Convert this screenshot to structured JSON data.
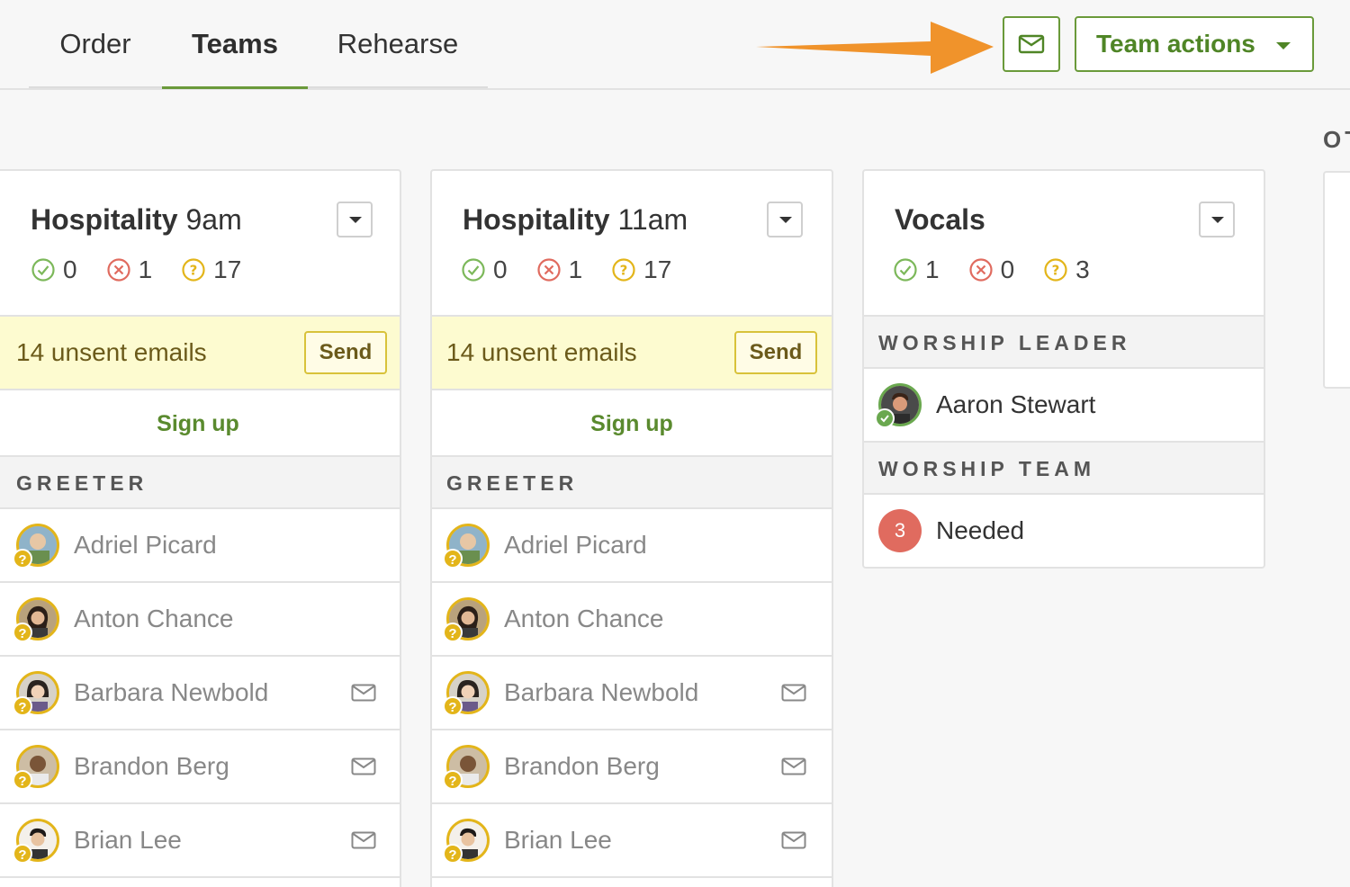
{
  "tabs": [
    {
      "label": "Order"
    },
    {
      "label": "Teams"
    },
    {
      "label": "Rehearse"
    }
  ],
  "toolbar": {
    "team_actions_label": "Team actions"
  },
  "offscreen_label": "OT",
  "cards": [
    {
      "title_bold": "Hospitality",
      "title_time": " 9am",
      "stats": {
        "confirmed": "0",
        "declined": "1",
        "unconfirmed": "17"
      },
      "unsent": {
        "text": "14 unsent emails",
        "send_label": "Send"
      },
      "signup_label": "Sign up",
      "section": "GREETER",
      "people": [
        {
          "name": "Adriel Picard",
          "mail": false
        },
        {
          "name": "Anton Chance",
          "mail": false
        },
        {
          "name": "Barbara Newbold",
          "mail": true
        },
        {
          "name": "Brandon Berg",
          "mail": true
        },
        {
          "name": "Brian Lee",
          "mail": true
        }
      ]
    },
    {
      "title_bold": "Hospitality",
      "title_time": " 11am",
      "stats": {
        "confirmed": "0",
        "declined": "1",
        "unconfirmed": "17"
      },
      "unsent": {
        "text": "14 unsent emails",
        "send_label": "Send"
      },
      "signup_label": "Sign up",
      "section": "GREETER",
      "people": [
        {
          "name": "Adriel Picard",
          "mail": false
        },
        {
          "name": "Anton Chance",
          "mail": false
        },
        {
          "name": "Barbara Newbold",
          "mail": true
        },
        {
          "name": "Brandon Berg",
          "mail": true
        },
        {
          "name": "Brian Lee",
          "mail": true
        }
      ]
    },
    {
      "title_bold": "Vocals",
      "stats": {
        "confirmed": "1",
        "declined": "0",
        "unconfirmed": "3"
      },
      "sections": [
        {
          "label": "WORSHIP LEADER",
          "person": "Aaron Stewart"
        },
        {
          "label": "WORSHIP TEAM",
          "needed_count": "3",
          "needed_label": "Needed"
        }
      ]
    }
  ],
  "colors": {
    "accent_green": "#6a9a3a",
    "arrow_orange": "#f0932b",
    "unsent_bg": "#fdfbd0",
    "pending_yellow": "#e3b51a",
    "declined_red": "#e06b5f"
  },
  "icons": [
    "mail-icon",
    "check-circle-icon",
    "x-circle-icon",
    "question-circle-icon",
    "caret-down-icon",
    "arrow-pointer"
  ]
}
